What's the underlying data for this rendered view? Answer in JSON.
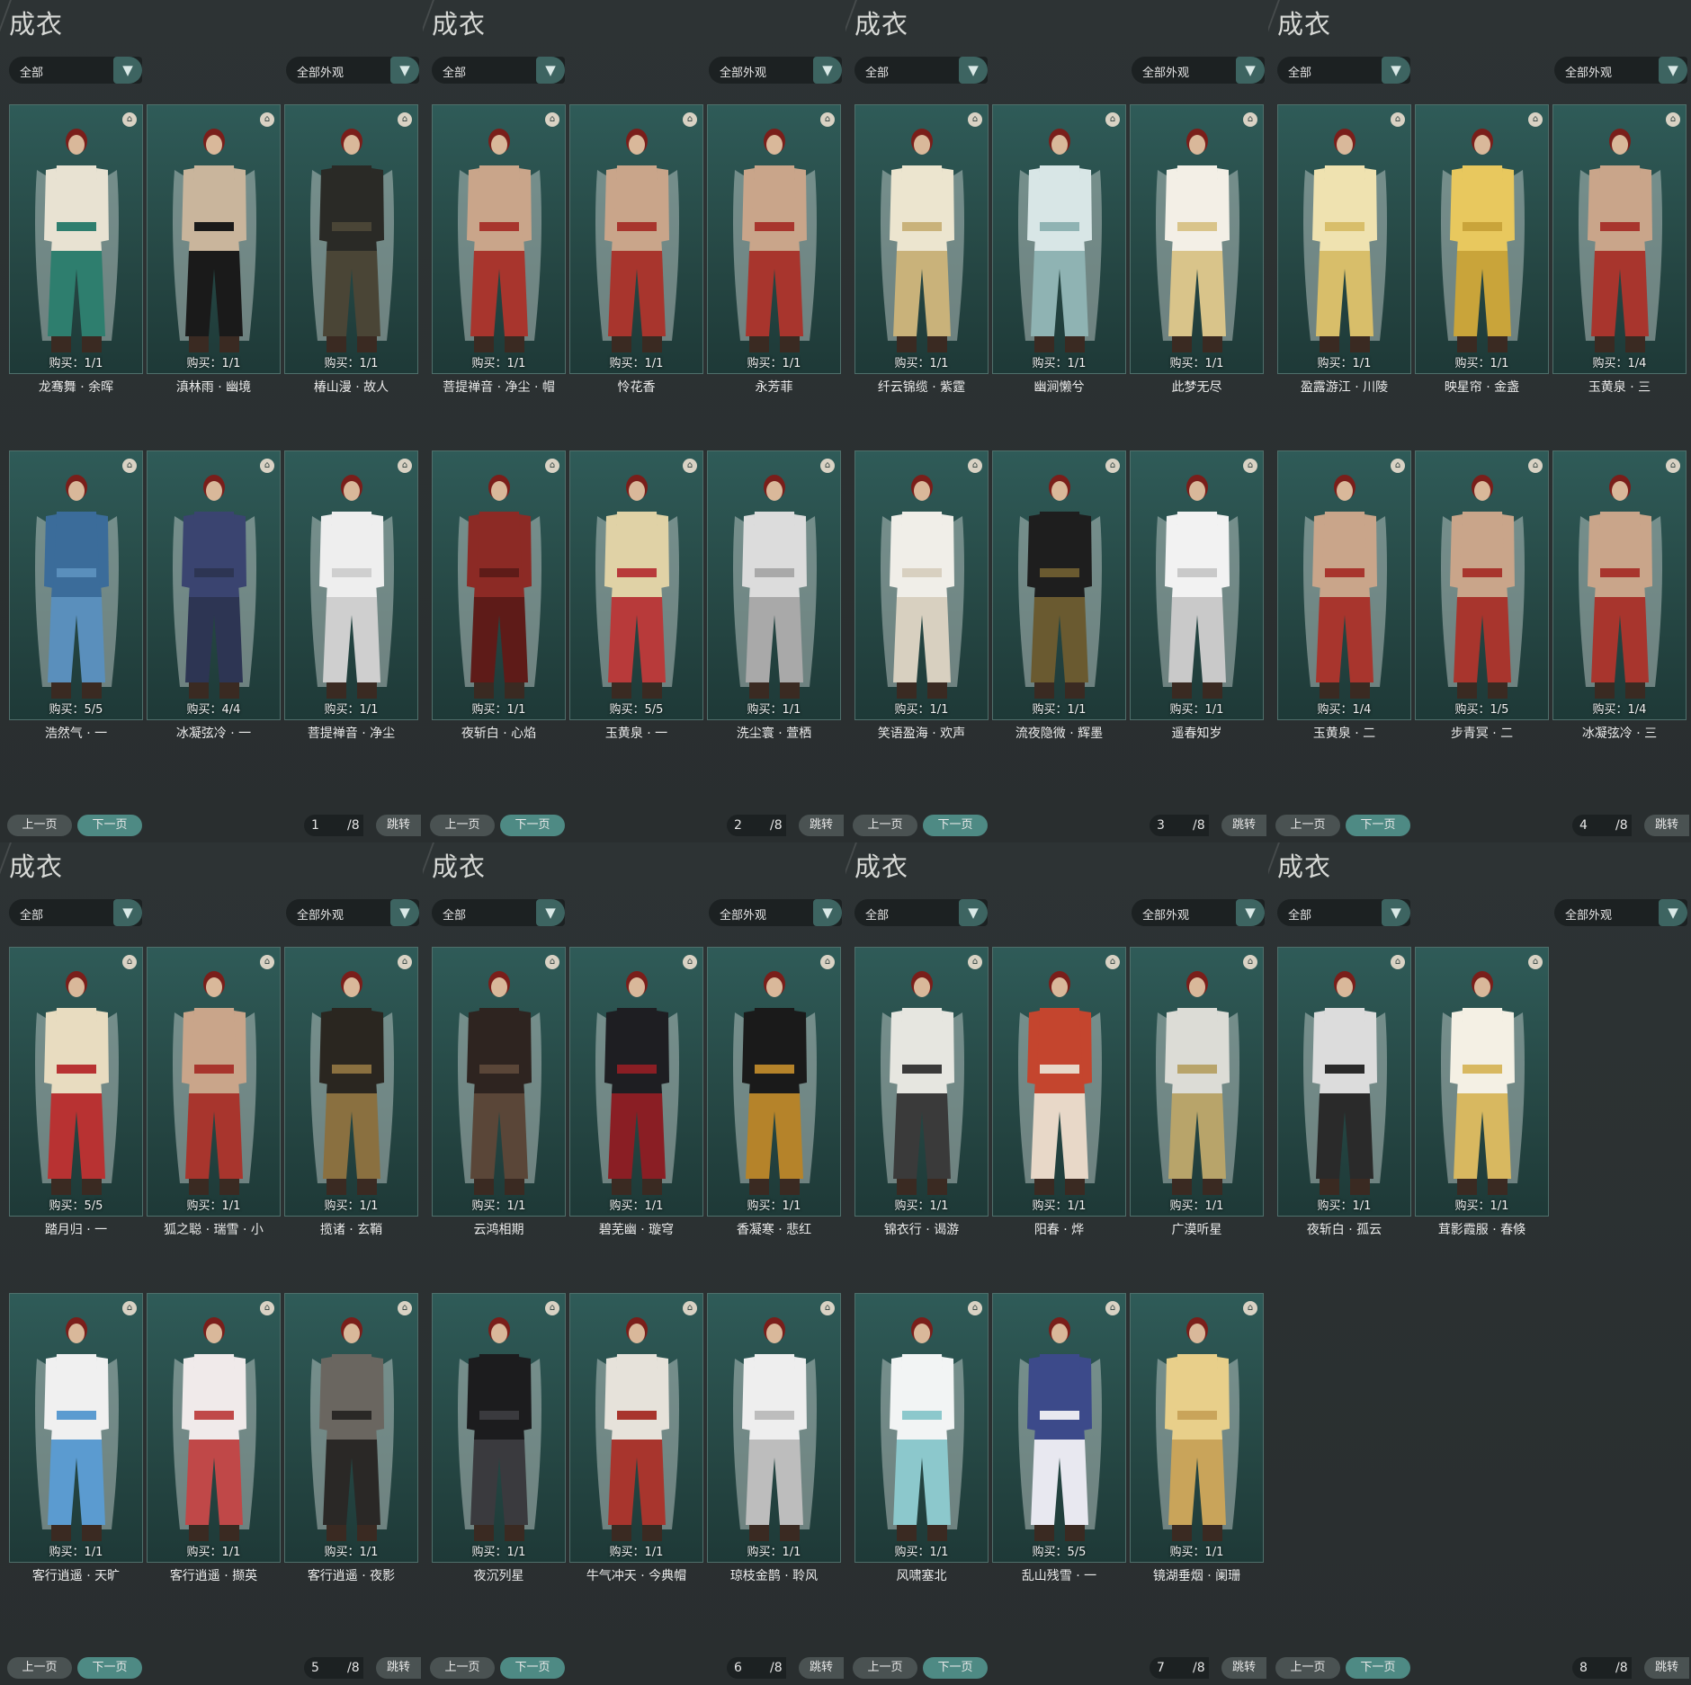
{
  "panels": [
    {
      "title": "成衣",
      "filter_left": "全部",
      "filter_right": "全部外观",
      "page": "1",
      "total": "/8",
      "prev_label": "上一页",
      "next_label": "下一页",
      "jump_label": "跳转",
      "items": [
        {
          "name": "龙骞舞 · 余晖",
          "buy": "购买：1/1",
          "colors": [
            "#e8e2d2",
            "#2e7e6e"
          ]
        },
        {
          "name": "滇林雨 · 幽境",
          "buy": "购买：1/1",
          "colors": [
            "#c9b59c",
            "#1a1a1a"
          ]
        },
        {
          "name": "椿山漫 · 故人",
          "buy": "购买：1/1",
          "colors": [
            "#2a2a26",
            "#4a4536"
          ]
        },
        {
          "name": "浩然气 · 一",
          "buy": "购买：5/5",
          "colors": [
            "#3b6c9a",
            "#5a8fbc"
          ]
        },
        {
          "name": "冰凝弦冷 · 一",
          "buy": "购买：4/4",
          "colors": [
            "#3a4470",
            "#2d3553"
          ]
        },
        {
          "name": "菩提禅音 · 净尘",
          "buy": "购买：1/1",
          "colors": [
            "#eeeeee",
            "#cfcfcf"
          ]
        }
      ]
    },
    {
      "title": "成衣",
      "filter_left": "全部",
      "filter_right": "全部外观",
      "page": "2",
      "total": "/8",
      "prev_label": "上一页",
      "next_label": "下一页",
      "jump_label": "跳转",
      "items": [
        {
          "name": "菩提禅音 · 净尘 · 帽",
          "buy": "购买：1/1",
          "colors": [
            "#c9a58a",
            "#a8352d"
          ]
        },
        {
          "name": "怜花香",
          "buy": "购买：1/1",
          "colors": [
            "#c9a58a",
            "#a8352d"
          ]
        },
        {
          "name": "永芳菲",
          "buy": "购买：1/1",
          "colors": [
            "#c9a58a",
            "#a8352d"
          ]
        },
        {
          "name": "夜斩白 · 心焰",
          "buy": "购买：1/1",
          "colors": [
            "#8c2a25",
            "#5e1b18"
          ]
        },
        {
          "name": "玉黄泉 · 一",
          "buy": "购买：5/5",
          "colors": [
            "#e0d2a6",
            "#b83a3a"
          ]
        },
        {
          "name": "洗尘寰 · 萱栖",
          "buy": "购买：1/1",
          "colors": [
            "#dcdcdc",
            "#a9a9a9"
          ]
        }
      ]
    },
    {
      "title": "成衣",
      "filter_left": "全部",
      "filter_right": "全部外观",
      "page": "3",
      "total": "/8",
      "prev_label": "上一页",
      "next_label": "下一页",
      "jump_label": "跳转",
      "items": [
        {
          "name": "纤云锦缆 · 紫霆",
          "buy": "购买：1/1",
          "colors": [
            "#ece5cf",
            "#c9b27a"
          ]
        },
        {
          "name": "幽涧懒兮",
          "buy": "购买：1/1",
          "colors": [
            "#d8e6e6",
            "#8fb3b3"
          ]
        },
        {
          "name": "此梦无尽",
          "buy": "购买：1/1",
          "colors": [
            "#f3efe6",
            "#d9c48a"
          ]
        },
        {
          "name": "笑语盈海 · 欢声",
          "buy": "购买：1/1",
          "colors": [
            "#f0eee8",
            "#d8d0c0"
          ]
        },
        {
          "name": "流夜隐微 · 辉墨",
          "buy": "购买：1/1",
          "colors": [
            "#1e1e1e",
            "#6a5a30"
          ]
        },
        {
          "name": "遥春知岁",
          "buy": "购买：1/1",
          "colors": [
            "#f2f2f2",
            "#c9c9c9"
          ]
        }
      ]
    },
    {
      "title": "成衣",
      "filter_left": "全部",
      "filter_right": "全部外观",
      "page": "4",
      "total": "/8",
      "prev_label": "上一页",
      "next_label": "下一页",
      "jump_label": "跳转",
      "items": [
        {
          "name": "盈露游江 · 川陵",
          "buy": "购买：1/1",
          "colors": [
            "#efe2b0",
            "#d8be6a"
          ]
        },
        {
          "name": "映星帘 · 金盏",
          "buy": "购买：1/1",
          "colors": [
            "#e8c85e",
            "#c9a43a"
          ]
        },
        {
          "name": "玉黄泉 · 三",
          "buy": "购买：1/4",
          "colors": [
            "#c9a58a",
            "#a8352d"
          ]
        },
        {
          "name": "玉黄泉 · 二",
          "buy": "购买：1/4",
          "colors": [
            "#c9a58a",
            "#a8352d"
          ]
        },
        {
          "name": "步青冥 · 二",
          "buy": "购买：1/5",
          "colors": [
            "#c9a58a",
            "#a8352d"
          ]
        },
        {
          "name": "冰凝弦冷 · 三",
          "buy": "购买：1/4",
          "colors": [
            "#c9a58a",
            "#a8352d"
          ]
        }
      ]
    },
    {
      "title": "成衣",
      "filter_left": "全部",
      "filter_right": "全部外观",
      "page": "5",
      "total": "/8",
      "prev_label": "上一页",
      "next_label": "下一页",
      "jump_label": "跳转",
      "items": [
        {
          "name": "踏月归 · 一",
          "buy": "购买：5/5",
          "colors": [
            "#e8dcc0",
            "#b83232"
          ]
        },
        {
          "name": "狐之聪 · 瑞雪 · 小",
          "buy": "购买：1/1",
          "colors": [
            "#c9a58a",
            "#a8352d"
          ]
        },
        {
          "name": "揽诸 · 玄鞘",
          "buy": "购买：1/1",
          "colors": [
            "#2a2620",
            "#8a7040"
          ]
        },
        {
          "name": "客行逍遥 · 天旷",
          "buy": "购买：1/1",
          "colors": [
            "#f0f0f0",
            "#5b9bd0"
          ]
        },
        {
          "name": "客行逍遥 · 撷英",
          "buy": "购买：1/1",
          "colors": [
            "#f0eaea",
            "#c04848"
          ]
        },
        {
          "name": "客行逍遥 · 夜影",
          "buy": "购买：1/1",
          "colors": [
            "#6a6660",
            "#2a2826"
          ]
        }
      ]
    },
    {
      "title": "成衣",
      "filter_left": "全部",
      "filter_right": "全部外观",
      "page": "6",
      "total": "/8",
      "prev_label": "上一页",
      "next_label": "下一页",
      "jump_label": "跳转",
      "items": [
        {
          "name": "云鸿相期",
          "buy": "购买：1/1",
          "colors": [
            "#2e2420",
            "#5a4638"
          ]
        },
        {
          "name": "碧芜幽 · 璇穹",
          "buy": "购买：1/1",
          "colors": [
            "#1e1e22",
            "#8a1e24"
          ]
        },
        {
          "name": "香凝寒 · 悲红",
          "buy": "购买：1/1",
          "colors": [
            "#1a1a1a",
            "#b5832a"
          ]
        },
        {
          "name": "夜沉列星",
          "buy": "购买：1/1",
          "colors": [
            "#1c1c1e",
            "#3a3a3e"
          ]
        },
        {
          "name": "牛气冲天 · 今典帽",
          "buy": "购买：1/1",
          "colors": [
            "#e6e2da",
            "#a8352d"
          ]
        },
        {
          "name": "琼枝金鹊 · 聆风",
          "buy": "购买：1/1",
          "colors": [
            "#eeeeee",
            "#bdbdbd"
          ]
        }
      ]
    },
    {
      "title": "成衣",
      "filter_left": "全部",
      "filter_right": "全部外观",
      "page": "7",
      "total": "/8",
      "prev_label": "上一页",
      "next_label": "下一页",
      "jump_label": "跳转",
      "items": [
        {
          "name": "锦衣行 · 谒游",
          "buy": "购买：1/1",
          "colors": [
            "#e6e6e0",
            "#3a3a3a"
          ]
        },
        {
          "name": "阳春 · 烨",
          "buy": "购买：1/1",
          "colors": [
            "#c4452e",
            "#e8d8c8"
          ]
        },
        {
          "name": "广漠听星",
          "buy": "购买：1/1",
          "colors": [
            "#dcdcd6",
            "#b8a46a"
          ]
        },
        {
          "name": "风啸塞北",
          "buy": "购买：1/1",
          "colors": [
            "#f2f4f4",
            "#8cc8cc"
          ]
        },
        {
          "name": "乱山残雪 · 一",
          "buy": "购买：5/5",
          "colors": [
            "#3c4a8a",
            "#e8e8f0"
          ]
        },
        {
          "name": "镜湖垂烟 · 阑珊",
          "buy": "购买：1/1",
          "colors": [
            "#e8cf8a",
            "#c9a45a"
          ]
        }
      ]
    },
    {
      "title": "成衣",
      "filter_left": "全部",
      "filter_right": "全部外观",
      "page": "8",
      "total": "/8",
      "prev_label": "上一页",
      "next_label": "下一页",
      "jump_label": "跳转",
      "items": [
        {
          "name": "夜斩白 · 孤云",
          "buy": "购买：1/1",
          "colors": [
            "#dcdcdc",
            "#2a2a2a"
          ]
        },
        {
          "name": "茸影霞服 · 春倏",
          "buy": "购买：1/1",
          "colors": [
            "#f4f0e4",
            "#d8b860"
          ]
        }
      ]
    }
  ]
}
